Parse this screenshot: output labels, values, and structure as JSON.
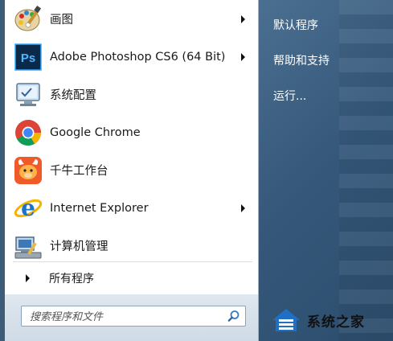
{
  "programs": [
    {
      "label": "画图",
      "icon": "paint-palette-icon",
      "has_arrow": true
    },
    {
      "label": "Adobe Photoshop CS6 (64 Bit)",
      "icon": "photoshop-icon",
      "has_arrow": true
    },
    {
      "label": "系统配置",
      "icon": "system-config-icon",
      "has_arrow": false
    },
    {
      "label": "Google Chrome",
      "icon": "chrome-icon",
      "has_arrow": false
    },
    {
      "label": "千牛工作台",
      "icon": "qianniu-icon",
      "has_arrow": false
    },
    {
      "label": "Internet Explorer",
      "icon": "ie-icon",
      "has_arrow": true
    },
    {
      "label": "计算机管理",
      "icon": "computer-management-icon",
      "has_arrow": false
    }
  ],
  "all_programs": {
    "label": "所有程序"
  },
  "search": {
    "placeholder": "搜索程序和文件"
  },
  "right_items": [
    {
      "label": "默认程序"
    },
    {
      "label": "帮助和支持"
    },
    {
      "label": "运行..."
    }
  ],
  "watermark": {
    "text": "系统之家"
  },
  "colors": {
    "right_panel": "#3d5e80",
    "ps_blue": "#001e36",
    "ps_text": "#31a8ff"
  }
}
